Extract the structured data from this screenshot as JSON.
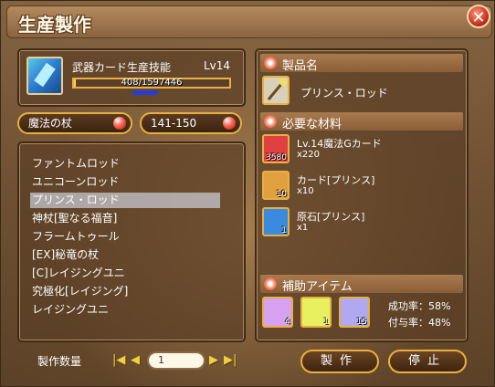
{
  "window": {
    "title": "生産製作",
    "close_label": "✕"
  },
  "skill": {
    "name": "武器カード生産技能",
    "level": "Lv14",
    "xp_text": "408/1597446",
    "xp_progress": 0.0003
  },
  "filters": {
    "category": "魔法の杖",
    "level_range": "141-150"
  },
  "recipes": [
    "ファントムロッド",
    "ユニコーンロッド",
    "プリンス・ロッド",
    "神杖[聖なる福音]",
    "フラームトゥール",
    "[EX]秘竜の杖",
    "[C]レイジングユニ",
    "究極化[レイジング]",
    "レイジングユニ"
  ],
  "selected_index": 2,
  "quantity": {
    "label": "製作数量",
    "value": "1"
  },
  "buttons": {
    "craft": "製作",
    "stop": "停止"
  },
  "product": {
    "section_label": "製品名",
    "name": "プリンス・ロッド"
  },
  "materials": {
    "section_label": "必要な材料",
    "items": [
      {
        "name": "Lv.14魔法Gカード",
        "qty": "x220",
        "owned": "3580"
      },
      {
        "name": "カード[プリンス]",
        "qty": "x10",
        "owned": "10"
      },
      {
        "name": "原石[プリンス]",
        "qty": "x1",
        "owned": "1"
      }
    ]
  },
  "assist": {
    "section_label": "補助アイテム",
    "items": [
      {
        "count": "4",
        "color": "#d8a0f0"
      },
      {
        "count": "1",
        "color": "#e8f060"
      },
      {
        "count": "15",
        "color": "#b0a8f0"
      }
    ],
    "success_rate": "成功率：58%",
    "enchant_rate": "付与率：48%"
  }
}
